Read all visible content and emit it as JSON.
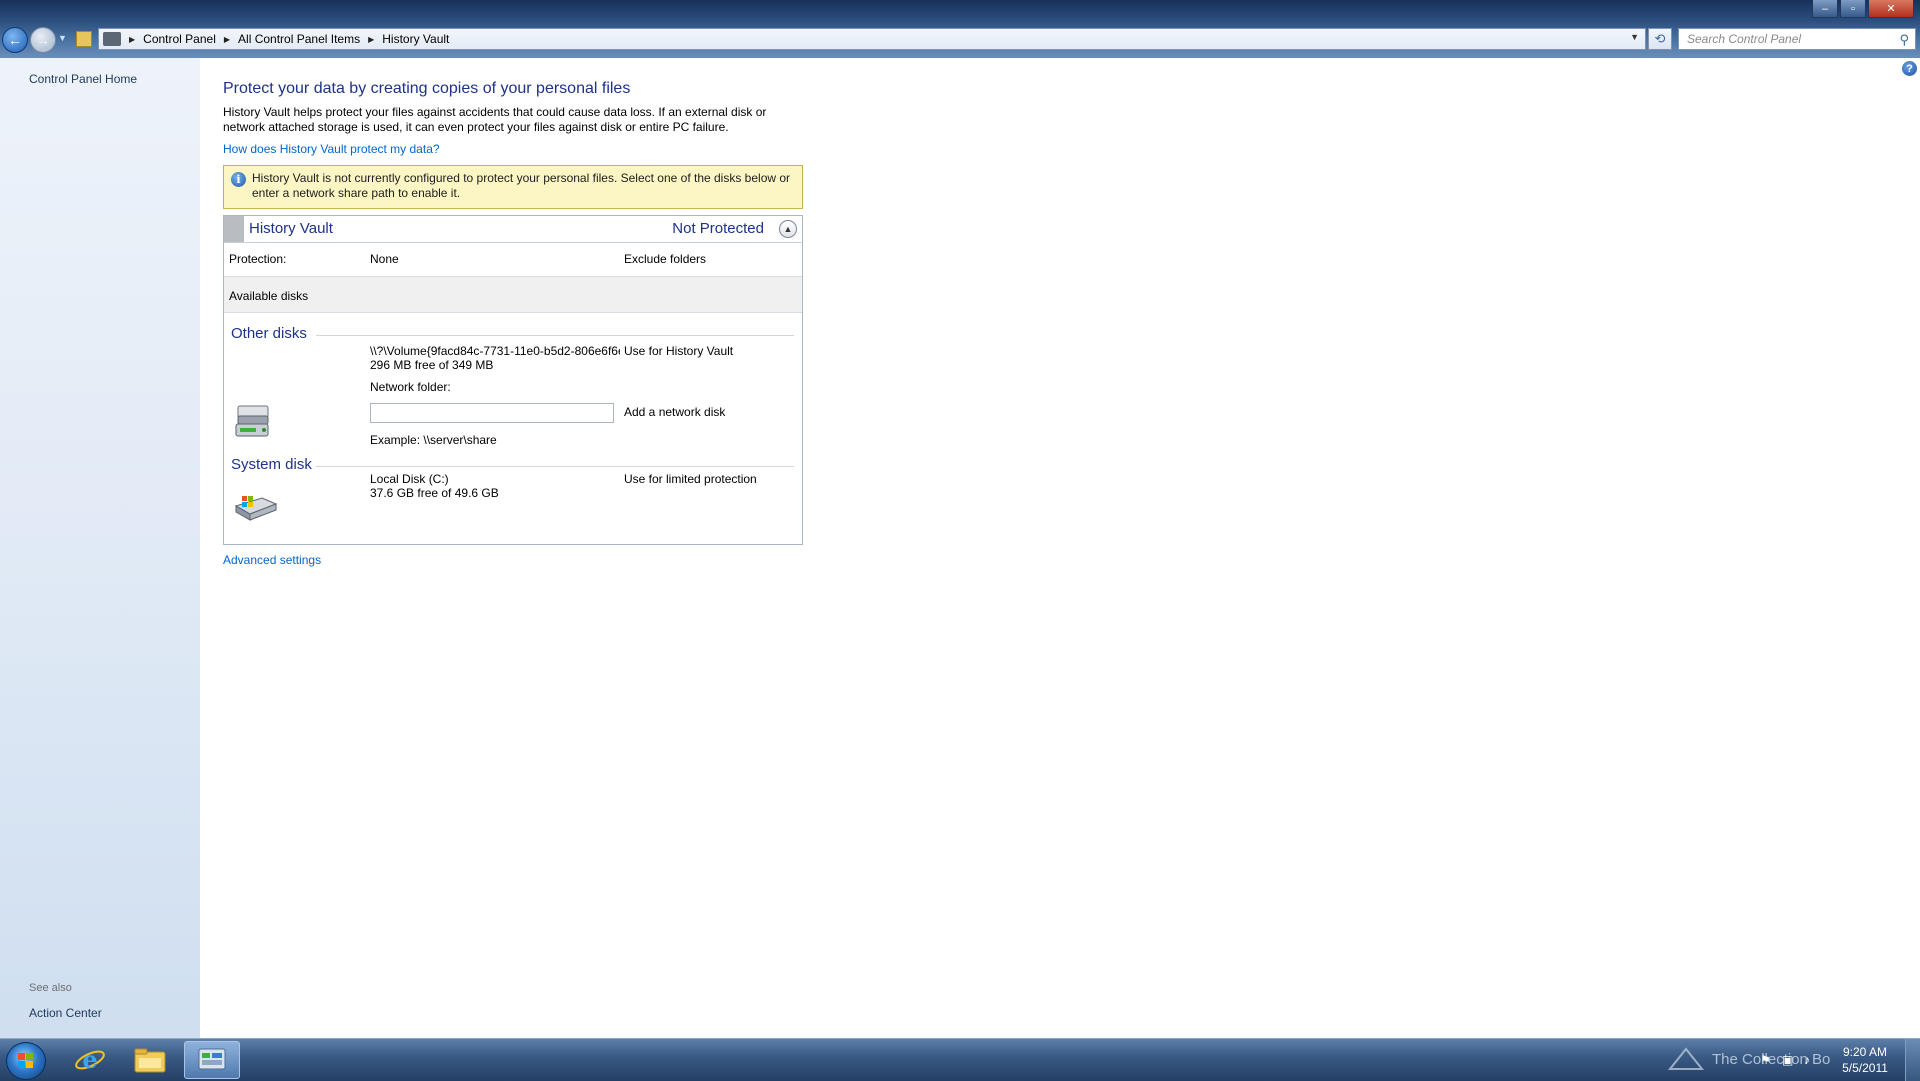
{
  "window": {
    "minimize_label": "‒",
    "maximize_label": "▫",
    "close_label": "✕"
  },
  "address_bar": {
    "crumbs": [
      "Control Panel",
      "All Control Panel Items",
      "History Vault"
    ]
  },
  "search": {
    "placeholder": "Search Control Panel"
  },
  "left_pane": {
    "home_link": "Control Panel Home",
    "see_also_label": "See also",
    "see_also_items": [
      "Action Center"
    ]
  },
  "main": {
    "heading": "Protect your data by creating copies of your personal files",
    "description": "History Vault helps protect your files against accidents that could cause data loss. If an external disk or network attached storage is used, it can even protect your files against disk or entire PC failure.",
    "how_link": "How does History Vault protect my data?",
    "info_message": "History Vault is not currently configured to protect your personal files. Select one of the disks below or enter a network share path to enable it.",
    "panel": {
      "title": "History Vault",
      "status": "Not Protected",
      "protection_label": "Protection:",
      "protection_value": "None",
      "exclude_link": "Exclude folders",
      "available_disks_label": "Available disks",
      "other_disks": {
        "title": "Other disks",
        "volume_name": "\\\\?\\Volume{9facd84c-7731-11e0-b5d2-806e6f6e",
        "volume_space": "296 MB free of 349 MB",
        "use_link": "Use for History Vault",
        "network_folder_label": "Network folder:",
        "network_folder_value": "",
        "add_network_link": "Add a network disk",
        "example_text": "Example: \\\\server\\share"
      },
      "system_disk": {
        "title": "System disk",
        "disk_name": "Local Disk (C:)",
        "disk_space": "37.6 GB free of 49.6 GB",
        "use_link": "Use for limited protection"
      }
    },
    "advanced_link": "Advanced settings"
  },
  "taskbar": {
    "watermark": "The Collection Bo",
    "time": "9:20 AM",
    "date": "5/5/2011"
  },
  "colors": {
    "link": "#0066cc",
    "heading": "#1e3287",
    "info_background": "#fcf5c4"
  }
}
